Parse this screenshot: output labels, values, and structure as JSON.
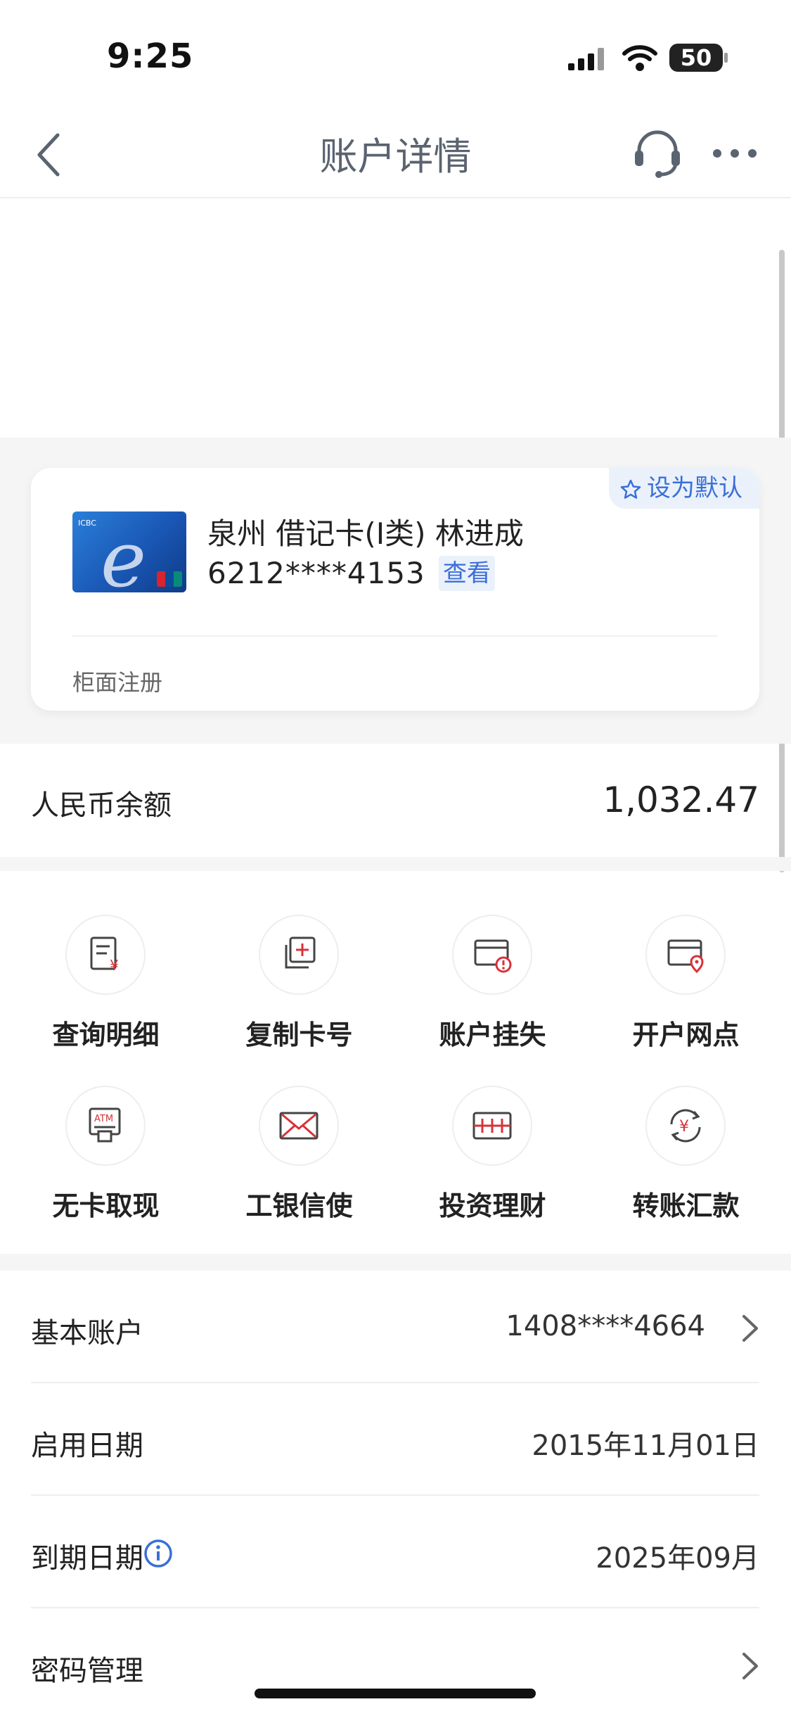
{
  "status_bar": {
    "time": "9:25",
    "battery": "50"
  },
  "nav": {
    "title": "账户详情"
  },
  "card": {
    "default_label": "设为默认",
    "name_line": "泉州 借记卡(Ⅰ类) 林进成",
    "number": "6212****4153",
    "view_label": "查看",
    "registration": "柜面注册"
  },
  "balance": {
    "label": "人民币余额",
    "value": "1,032.47"
  },
  "grid": [
    {
      "label": "查询明细",
      "icon": "statement-icon"
    },
    {
      "label": "复制卡号",
      "icon": "copy-card-icon"
    },
    {
      "label": "账户挂失",
      "icon": "report-loss-icon"
    },
    {
      "label": "开户网点",
      "icon": "branch-location-icon"
    },
    {
      "label": "无卡取现",
      "icon": "atm-icon"
    },
    {
      "label": "工银信使",
      "icon": "mail-icon"
    },
    {
      "label": "投资理财",
      "icon": "investment-icon"
    },
    {
      "label": "转账汇款",
      "icon": "transfer-icon"
    }
  ],
  "details": [
    {
      "label": "基本账户",
      "value": "1408****4664"
    },
    {
      "label": "启用日期",
      "value": "2015年11月01日"
    },
    {
      "label": "到期日期",
      "value": "2025年09月"
    },
    {
      "label": "密码管理",
      "value": ""
    }
  ],
  "colors": {
    "accent": "#3a6fd8",
    "icon_red": "#d7333a",
    "nav_title": "#5a6470"
  }
}
